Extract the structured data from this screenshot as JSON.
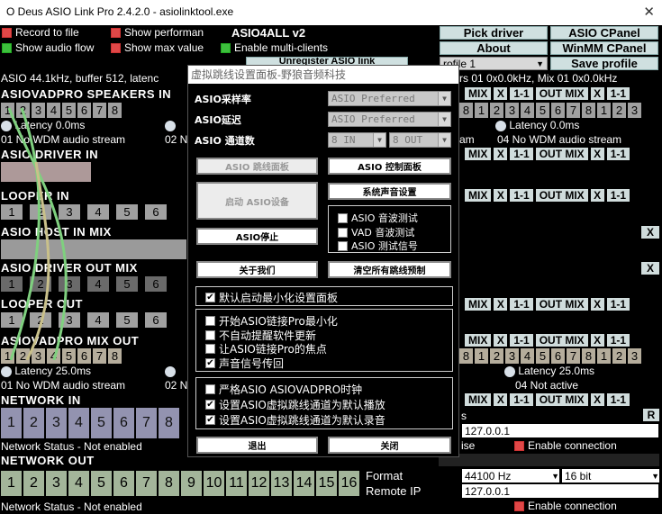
{
  "window": {
    "title": "O Deus ASIO Link Pro 2.4.2.0 - asiolinktool.exe",
    "close": "✕"
  },
  "top_checks": {
    "record": "Record to file",
    "show_perf": "Show performan",
    "show_audio_flow": "Show audio flow",
    "show_max": "Show max value",
    "enable_multi": "Enable multi-clients",
    "asio4all": "ASIO4ALL v2",
    "unregister": "Unregister ASIO link"
  },
  "buttons": {
    "pick_driver": "Pick driver",
    "asio_cpanel": "ASIO CPanel",
    "about": "About",
    "winmm_cpanel": "WinMM CPanel",
    "save_profile": "Save profile"
  },
  "profile": {
    "value": "rofile 1"
  },
  "status_line": "ASIO 44.1kHz, buffer 512, latenc",
  "status_right": "rs 01 0x0.0kHz, Mix 01 0x0.0kHz",
  "sections": {
    "asiovadpro_speakers_in": "ASIOVADPRO SPEAKERS IN",
    "asio_driver_in": "ASIO DRIVER IN",
    "looper_in": "LOOPER IN",
    "asio_host_in_mix": "ASIO HOST IN MIX",
    "asio_driver_out_mix": "ASIO DRIVER OUT MIX",
    "looper_out": "LOOPER OUT",
    "asiovadpro_mix_out": "ASIOVADPRO MIX OUT",
    "network_in": "NETWORK IN",
    "network_out": "NETWORK OUT"
  },
  "channels8": [
    "1",
    "2",
    "3",
    "4",
    "5",
    "6",
    "7",
    "8"
  ],
  "channels16": [
    "1",
    "2",
    "3",
    "4",
    "5",
    "6",
    "7",
    "8",
    "9",
    "10",
    "11",
    "12",
    "13",
    "14",
    "15",
    "16"
  ],
  "latency": {
    "in_left": "Latency 0.0ms",
    "in_right": "Latency 0.0ms",
    "out_left": "Latency 25.0ms",
    "out_right": "Latency 25.0ms"
  },
  "streams": {
    "left1": "01 No WDM audio stream",
    "mid1": "02 N",
    "right1a": "am",
    "right1b": "04 No WDM audio stream",
    "left2": "01 No WDM audio stream",
    "mid2": "02 N",
    "right2": "04 Not active"
  },
  "mix_labels": {
    "mix": "MIX",
    "x": "X",
    "one": "1-1",
    "out_mix": "OUT MIX"
  },
  "network": {
    "in_status": "Network Status - Not enabled",
    "out_status": "Network Status - Not enabled",
    "s_label": "s",
    "ip1": "127.0.0.1",
    "r_btn": "R",
    "ise_label": "ise",
    "enable_conn1": "Enable connection",
    "format_label": "Format",
    "remote_ip_label": "Remote IP",
    "rate": "44100 Hz",
    "bits": "16 bit",
    "ip2": "127.0.0.1",
    "enable_conn2": "Enable connection"
  },
  "dialog": {
    "title": "虚拟跳线设置面板-野狼音频科技",
    "sample_rate_label": "ASIO采样率",
    "latency_label": "ASIO延迟",
    "channels_label": "ASIO 通道数",
    "sample_rate_value": "ASIO Preferred",
    "latency_value": "ASIO Preferred",
    "in_value": "8 IN",
    "out_value": "8 OUT",
    "btn_patch_panel": "ASIO 跳线面板",
    "btn_control_panel": "ASIO 控制面板",
    "btn_start": "启动 ASIO设备",
    "btn_system_sound": "系统声音设置",
    "btn_stop": "ASIO停止",
    "chk_wave": "ASIO 音波测试",
    "chk_vad": "VAD 音波测试",
    "chk_signal": "ASIO 测试信号",
    "btn_about": "关于我们",
    "btn_clear": "清空所有跳线预制",
    "chk_minimize_default": "默认启动最小化设置面板",
    "chk_startup_min": "开始ASIO链接Pro最小化",
    "chk_no_update": "不自动提醒软件更新",
    "chk_focus": "让ASIO链接Pro的焦点",
    "chk_feedback": "声音信号传回",
    "chk_strict": "严格ASIO ASIOVADPRO时钟",
    "chk_default_play": "设置ASIO虚拟跳线通道为默认播放",
    "chk_default_rec": "设置ASIO虚拟跳线通道为默认录音",
    "btn_exit": "退出",
    "btn_close": "关闭",
    "check_mark": "✔"
  },
  "colors": {
    "red": "#e04848",
    "green": "#3dbf3d",
    "cable_green": "#7fd07f",
    "cable_tan": "#c9c08a"
  }
}
